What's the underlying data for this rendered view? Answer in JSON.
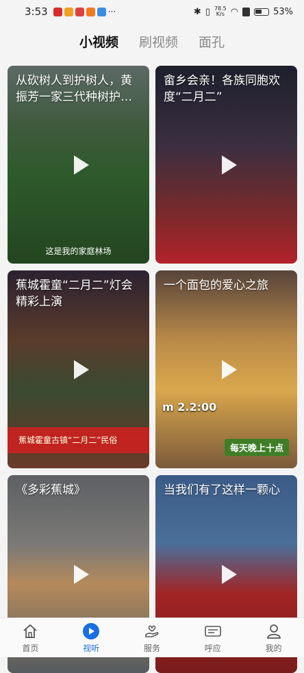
{
  "status": {
    "time": "3:53",
    "netspeed_top": "78.5",
    "netspeed_unit": "K/s",
    "battery": "53%"
  },
  "tabs": [
    {
      "label": "小视频",
      "active": true
    },
    {
      "label": "刷视频",
      "active": false
    },
    {
      "label": "面孔",
      "active": false
    }
  ],
  "cards": [
    {
      "title": "从砍树人到护树人，黄振芳一家三代种树护…",
      "caption": "这是我的家庭林场"
    },
    {
      "title": "畲乡会亲！各族同胞欢度“二月二”"
    },
    {
      "title": "蕉城霍童“二月二”灯会精彩上演",
      "overlay": "蕉城霍童古镇“二月二”民俗"
    },
    {
      "title": "一个面包的爱心之旅",
      "time_text": "m 2.2:00",
      "badge": "每天晚上十点"
    },
    {
      "title": "《多彩蕉城》"
    },
    {
      "title": "当我们有了这样一颗心"
    }
  ],
  "nav": [
    {
      "label": "首页",
      "icon": "home-icon",
      "active": false
    },
    {
      "label": "视听",
      "icon": "video-play-icon",
      "active": true
    },
    {
      "label": "服务",
      "icon": "service-hand-icon",
      "active": false
    },
    {
      "label": "呼应",
      "icon": "respond-icon",
      "active": false
    },
    {
      "label": "我的",
      "icon": "user-icon",
      "active": false
    }
  ],
  "colors": {
    "accent": "#1a6fe0"
  }
}
